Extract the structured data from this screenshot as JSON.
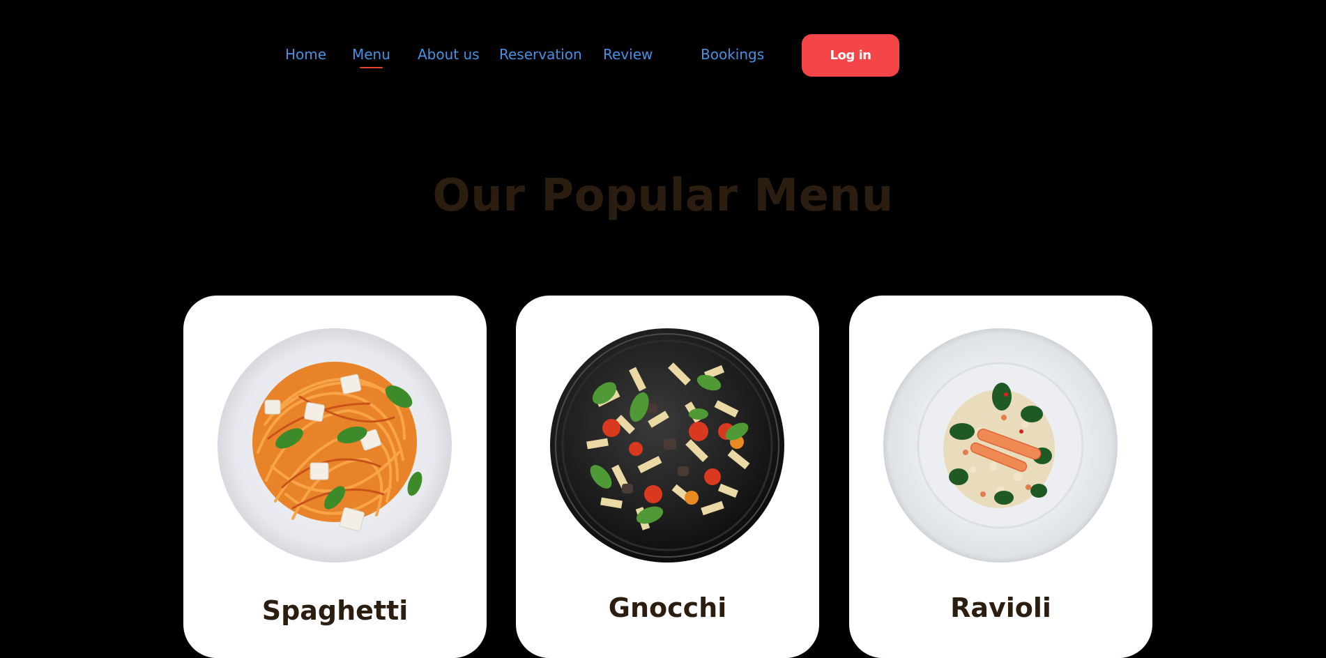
{
  "nav": {
    "items": [
      {
        "label": "Home",
        "active": false
      },
      {
        "label": "Menu",
        "active": true
      },
      {
        "label": "About us",
        "active": false
      },
      {
        "label": "Reservation",
        "active": false
      },
      {
        "label": "Review",
        "active": false
      },
      {
        "label": "Bookings",
        "active": false
      }
    ],
    "login_label": "Log in"
  },
  "section": {
    "title": "Our Popular Menu"
  },
  "menu": {
    "cards": [
      {
        "name": "Spaghetti",
        "image": "spaghetti-plate-image"
      },
      {
        "name": "Gnocchi",
        "image": "penne-pasta-bowl-image"
      },
      {
        "name": "Ravioli",
        "image": "risotto-plate-image"
      }
    ]
  },
  "colors": {
    "background": "#000000",
    "nav_link": "#4a90e2",
    "active_underline": "#e4442f",
    "login_button": "#f44548",
    "title": "#2b1d0f",
    "card": "#ffffff"
  }
}
